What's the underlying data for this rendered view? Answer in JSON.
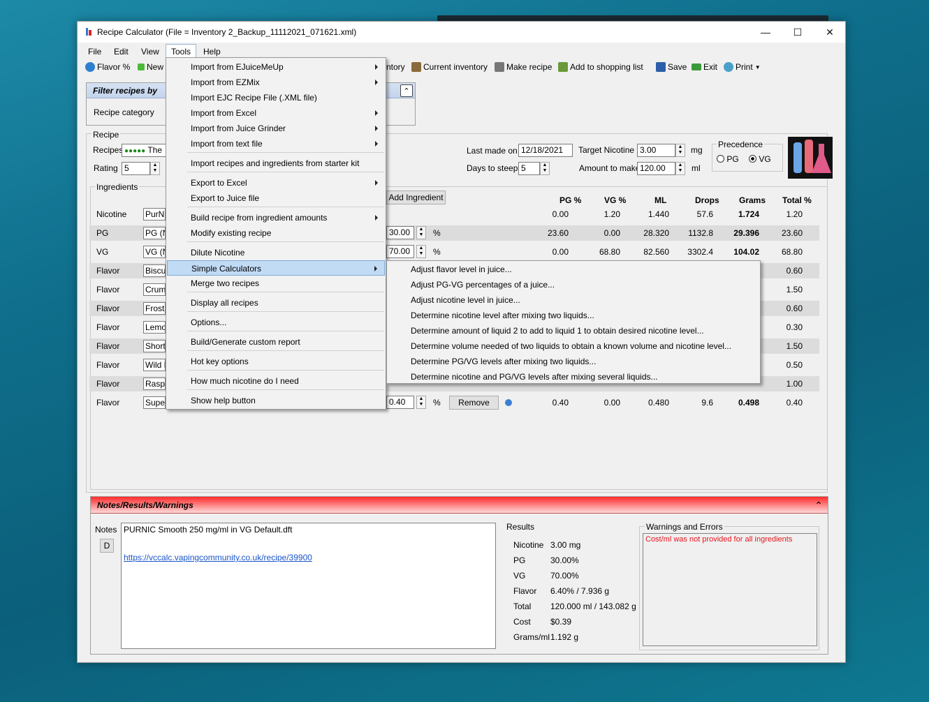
{
  "window": {
    "title": "Recipe Calculator (File = Inventory 2_Backup_11112021_071621.xml)"
  },
  "menubar": [
    "File",
    "Edit",
    "View",
    "Tools",
    "Help"
  ],
  "toolbar": {
    "flavor_pct": "Flavor %",
    "new": "New",
    "inventory_tail": "ntory",
    "current_inventory": "Current inventory",
    "make_recipe": "Make recipe",
    "add_shopping": "Add to shopping list",
    "save": "Save",
    "exit": "Exit",
    "print": "Print"
  },
  "filter": {
    "title": "Filter recipes by",
    "recipe_category_label": "Recipe category"
  },
  "recipe": {
    "group_label": "Recipe",
    "recipes_label": "Recipes",
    "recipe_value": "The",
    "rating_label": "Rating",
    "rating_value": "5",
    "last_made_label": "Last made on",
    "last_made_value": "12/18/2021",
    "days_steep_label": "Days to steep",
    "days_steep_value": "5",
    "target_nic_label": "Target Nicotine",
    "target_nic_value": "3.00",
    "target_nic_unit": "mg",
    "amount_label": "Amount to make",
    "amount_value": "120.00",
    "amount_unit": "ml",
    "precedence_label": "Precedence",
    "prec_pg": "PG",
    "prec_vg": "VG"
  },
  "ingredients": {
    "label": "Ingredients",
    "add_button": "Add Ingredient",
    "headers": [
      "PG %",
      "VG %",
      "ML",
      "Drops",
      "Grams",
      "Total %"
    ],
    "rows": [
      {
        "type": "Nicotine",
        "name": "PurNic",
        "pct": "",
        "pg": "0.00",
        "vg": "1.20",
        "ml": "1.440",
        "drops": "57.6",
        "grams": "1.724",
        "total": "1.20"
      },
      {
        "type": "PG",
        "name": "PG (N",
        "pct": "30.00",
        "pg": "23.60",
        "vg": "0.00",
        "ml": "28.320",
        "drops": "1132.8",
        "grams": "29.396",
        "total": "23.60"
      },
      {
        "type": "VG",
        "name": "VG (N",
        "pct": "70.00",
        "pg": "0.00",
        "vg": "68.80",
        "ml": "82.560",
        "drops": "3302.4",
        "grams": "104.02",
        "total": "68.80"
      },
      {
        "type": "Flavor",
        "name": "Biscui",
        "total": "0.60"
      },
      {
        "type": "Flavor",
        "name": "Crumb",
        "total": "1.50"
      },
      {
        "type": "Flavor",
        "name": "Frostin",
        "total": "0.60"
      },
      {
        "type": "Flavor",
        "name": "Lemon",
        "total": "0.30"
      },
      {
        "type": "Flavor",
        "name": "Shortb",
        "total": "1.50"
      },
      {
        "type": "Flavor",
        "name": "Wild F",
        "total": "0.50"
      },
      {
        "type": "Flavor",
        "name": "Raspb",
        "total": "1.00"
      },
      {
        "type": "Flavor",
        "name": "Super",
        "pct": "0.40",
        "pg": "0.40",
        "vg": "0.00",
        "ml": "0.480",
        "drops": "9.6",
        "grams": "0.498",
        "total": "0.40"
      }
    ],
    "pct_sign": "%",
    "remove_label": "Remove"
  },
  "notes": {
    "title": "Notes/Results/Warnings",
    "notes_label": "Notes",
    "d_button": "D",
    "text": "PURNIC Smooth 250 mg/ml in VG Default.dft",
    "link": "https://vccalc.vapingcommunity.co.uk/recipe/39900",
    "results_label": "Results",
    "results": [
      {
        "k": "Nicotine",
        "v": "3.00 mg"
      },
      {
        "k": "PG",
        "v": "30.00%"
      },
      {
        "k": "VG",
        "v": "70.00%"
      },
      {
        "k": "Flavor",
        "v": "6.40% / 7.936 g"
      },
      {
        "k": "Total",
        "v": "120.000 ml / 143.082 g"
      },
      {
        "k": "Cost",
        "v": "$0.39"
      },
      {
        "k": "Grams/ml",
        "v": "1.192 g"
      }
    ],
    "warnings_label": "Warnings and Errors",
    "warning_text": "Cost/ml was not provided for all ingredients"
  },
  "tools_menu": [
    {
      "label": "Import from EJuiceMeUp",
      "sub": true
    },
    {
      "label": "Import from EZMix",
      "sub": true
    },
    {
      "label": "Import EJC Recipe File (.XML file)",
      "sub": false
    },
    {
      "label": "Import from Excel",
      "sub": true
    },
    {
      "label": "Import from Juice Grinder",
      "sub": true
    },
    {
      "label": "Import from text file",
      "sub": true
    },
    {
      "label": "Import recipes and ingredients from starter kit",
      "sub": false
    },
    {
      "label": "Export to Excel",
      "sub": true
    },
    {
      "label": "Export to Juice file",
      "sub": false
    },
    {
      "label": "Build recipe from ingredient amounts",
      "sub": true
    },
    {
      "label": "Modify existing recipe",
      "sub": false
    },
    {
      "label": "Dilute Nicotine",
      "sub": false
    },
    {
      "label": "Simple Calculators",
      "sub": true
    },
    {
      "label": "Merge two recipes",
      "sub": false
    },
    {
      "label": "Display all recipes",
      "sub": false
    },
    {
      "label": "Options...",
      "sub": false
    },
    {
      "label": "Build/Generate custom report",
      "sub": false
    },
    {
      "label": "Hot key options",
      "sub": false
    },
    {
      "label": "How much nicotine do I need",
      "sub": false
    },
    {
      "label": "Show help button",
      "sub": false
    }
  ],
  "simple_calculators": [
    "Adjust flavor level in juice...",
    "Adjust PG-VG percentages of a juice...",
    "Adjust nicotine level in juice...",
    "Determine nicotine level after mixing two liquids...",
    "Determine amount of liquid 2 to add to liquid 1 to obtain desired nicotine level...",
    "Determine volume needed of two liquids to obtain a known volume and nicotine level...",
    "Determine PG/VG levels after mixing two liquids...",
    "Determine nicotine and PG/VG levels after mixing several liquids..."
  ],
  "colors": {
    "accent": "#c1dbf5",
    "warning": "#e8141c",
    "link": "#1a55c8"
  }
}
